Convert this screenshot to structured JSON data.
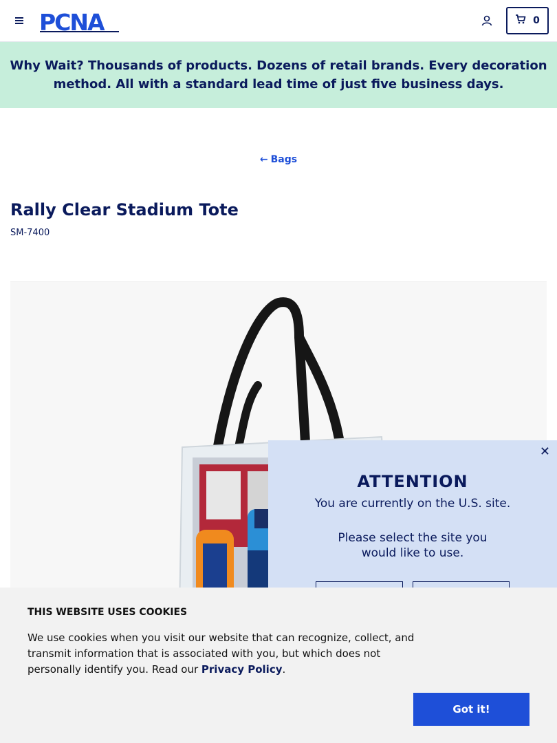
{
  "header": {
    "logo_text": "PCNA",
    "cart_count": "0",
    "icons": {
      "menu": "hamburger-icon",
      "account": "user-icon",
      "cart": "cart-icon"
    },
    "brand_color": "#0a1a5c"
  },
  "promo": {
    "lead": "Why Wait?",
    "text": " Thousands of products. Dozens of retail brands. Every decoration method. All with a standard lead time of just five business days.",
    "bg_color": "#c6eedb"
  },
  "breadcrumb": {
    "back_label": "Bags",
    "icon": "arrow-left-icon"
  },
  "product": {
    "title": "Rally Clear Stadium Tote",
    "sku": "SM-7400"
  },
  "attention_modal": {
    "title": "ATTENTION",
    "message": "You are currently on the U.S. site.",
    "select_text": "Please select the site you would like to use.",
    "close_icon": "close-icon",
    "bg_color": "#d4e0f5"
  },
  "cookie_banner": {
    "title": "THIS WEBSITE USES COOKIES",
    "text_before": "We use cookies when you visit our website that can recognize, collect, and transmit information that is associated with you, but which does not personally identify you. Read our ",
    "link_label": "Privacy Policy",
    "text_after": ".",
    "button_label": "Got it!",
    "button_color": "#1e4fd8"
  }
}
